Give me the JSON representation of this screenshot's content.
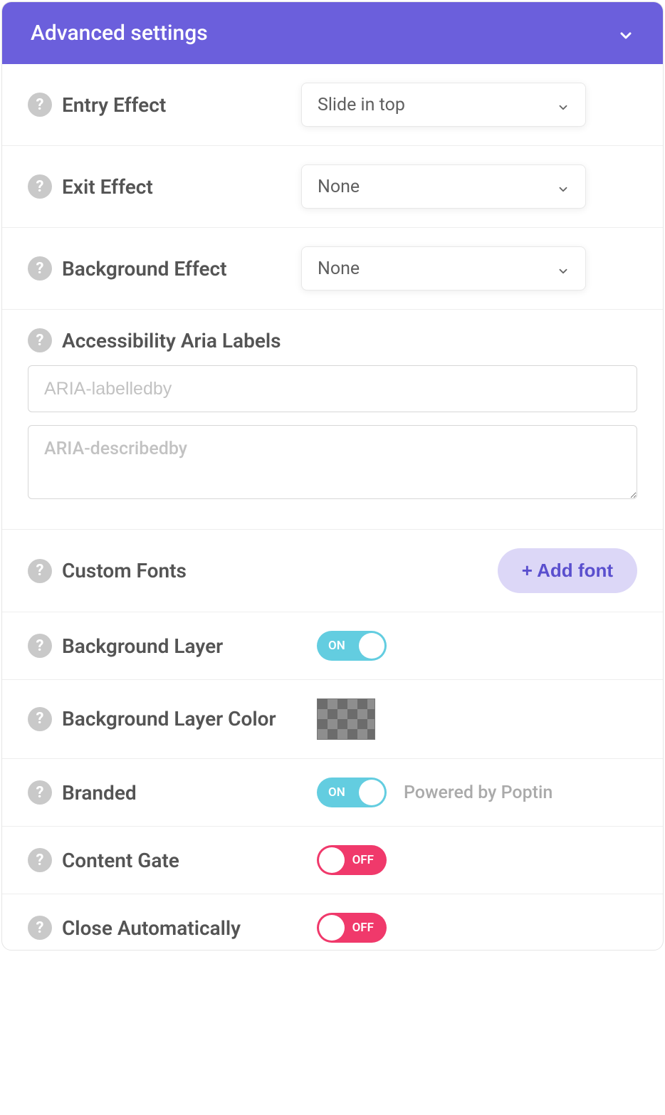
{
  "header": {
    "title": "Advanced settings"
  },
  "rows": {
    "entry_effect": {
      "label": "Entry Effect",
      "value": "Slide in top"
    },
    "exit_effect": {
      "label": "Exit Effect",
      "value": "None"
    },
    "background_effect": {
      "label": "Background Effect",
      "value": "None"
    },
    "accessibility": {
      "label": "Accessibility Aria Labels",
      "labelledby_placeholder": "ARIA-labelledby",
      "labelledby_value": "",
      "describedby_placeholder": "ARIA-describedby",
      "describedby_value": ""
    },
    "custom_fonts": {
      "label": "Custom Fonts",
      "add_button": "+ Add font"
    },
    "background_layer": {
      "label": "Background Layer",
      "toggle_state": "on",
      "toggle_label": "ON"
    },
    "background_layer_color": {
      "label": "Background Layer Color"
    },
    "branded": {
      "label": "Branded",
      "toggle_state": "on",
      "toggle_label": "ON",
      "caption": "Powered by Poptin"
    },
    "content_gate": {
      "label": "Content Gate",
      "toggle_state": "off",
      "toggle_label": "OFF"
    },
    "close_automatically": {
      "label": "Close Automatically",
      "toggle_state": "off",
      "toggle_label": "OFF"
    }
  },
  "icons": {
    "help_glyph": "?"
  }
}
